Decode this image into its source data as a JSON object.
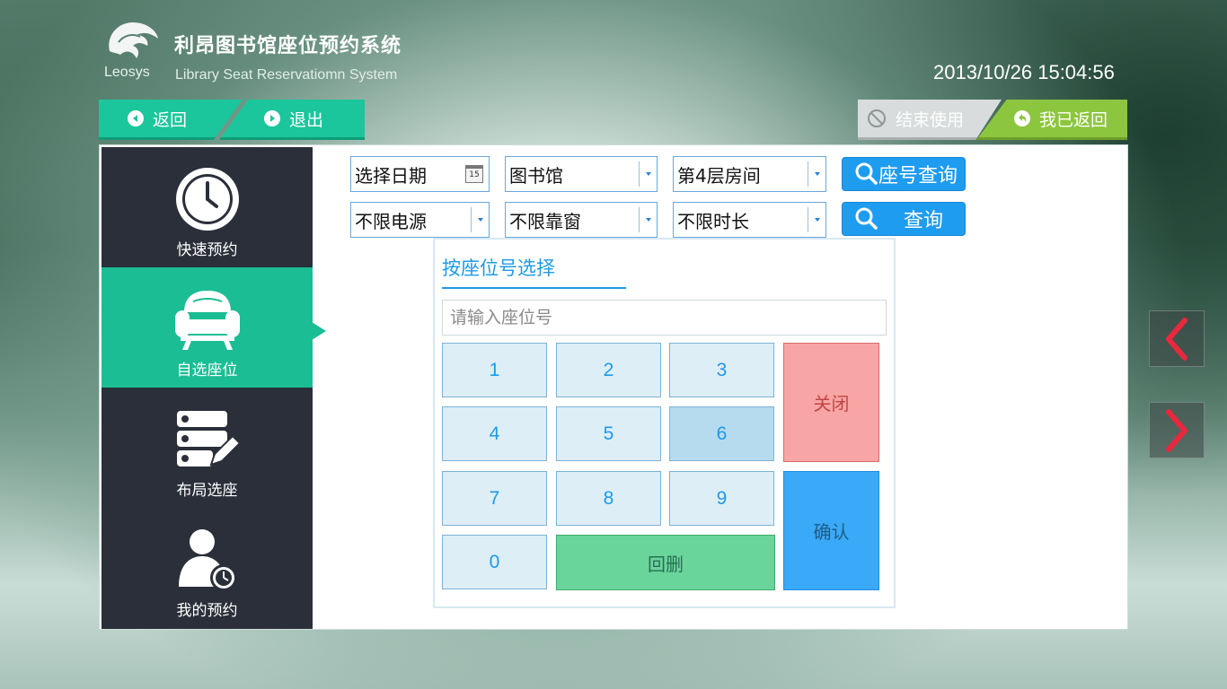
{
  "header": {
    "logo_text": "Leosys",
    "title": "利昂图书馆座位预约系统",
    "subtitle": "Library Seat Reservatiomn System",
    "datetime": "2013/10/26 15:04:56"
  },
  "topbar": {
    "back_label": "返回",
    "exit_label": "退出",
    "end_use_label": "结束使用",
    "returned_label": "我已返回"
  },
  "sidebar": {
    "items": [
      {
        "label": "快速预约",
        "icon": "clock-icon"
      },
      {
        "label": "自选座位",
        "icon": "sofa-icon",
        "active": true
      },
      {
        "label": "布局选座",
        "icon": "layout-edit-icon"
      },
      {
        "label": "我的预约",
        "icon": "user-clock-icon"
      }
    ]
  },
  "filters": {
    "date_placeholder": "选择日期",
    "date_icon_text": "15",
    "building": "图书馆",
    "floor": "第4层房间",
    "power": "不限电源",
    "window": "不限靠窗",
    "duration": "不限时长",
    "seat_query_label": "座号查询",
    "query_label": "查询"
  },
  "keypad": {
    "title": "按座位号选择",
    "input_placeholder": "请输入座位号",
    "keys": [
      "1",
      "2",
      "3",
      "4",
      "5",
      "6",
      "7",
      "8",
      "9",
      "0"
    ],
    "pressed_key": "6",
    "delete_label": "回删",
    "close_label": "关闭",
    "confirm_label": "确认"
  },
  "colors": {
    "accent_green": "#1bbd94",
    "sidebar_bg": "#2a2f3a",
    "query_blue": "#1e9cf0",
    "returned_green": "#8cc63f",
    "arrow_red": "#e8283e"
  }
}
